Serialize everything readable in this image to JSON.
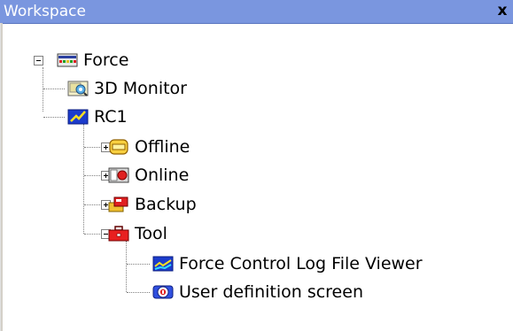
{
  "panel": {
    "title": "Workspace",
    "close_label": "x"
  },
  "tree": {
    "root": {
      "label": "Force",
      "icon": "force-icon",
      "expanded": true
    },
    "monitor": {
      "label": "3D Monitor",
      "icon": "3d-monitor-icon"
    },
    "rc1": {
      "label": "RC1",
      "icon": "rc1-icon",
      "expanded": true
    },
    "offline": {
      "label": "Offline",
      "icon": "offline-icon",
      "expanded": false
    },
    "online": {
      "label": "Online",
      "icon": "online-icon",
      "expanded": false
    },
    "backup": {
      "label": "Backup",
      "icon": "backup-icon",
      "expanded": false
    },
    "tool": {
      "label": "Tool",
      "icon": "toolbox-icon",
      "expanded": true
    },
    "log_viewer": {
      "label": "Force Control Log File Viewer",
      "icon": "chart-viewer-icon"
    },
    "user_definition": {
      "label": "User definition screen",
      "icon": "user-definition-icon"
    }
  },
  "colors": {
    "titlebar": "#7a96df",
    "title_text": "#ffffff"
  }
}
